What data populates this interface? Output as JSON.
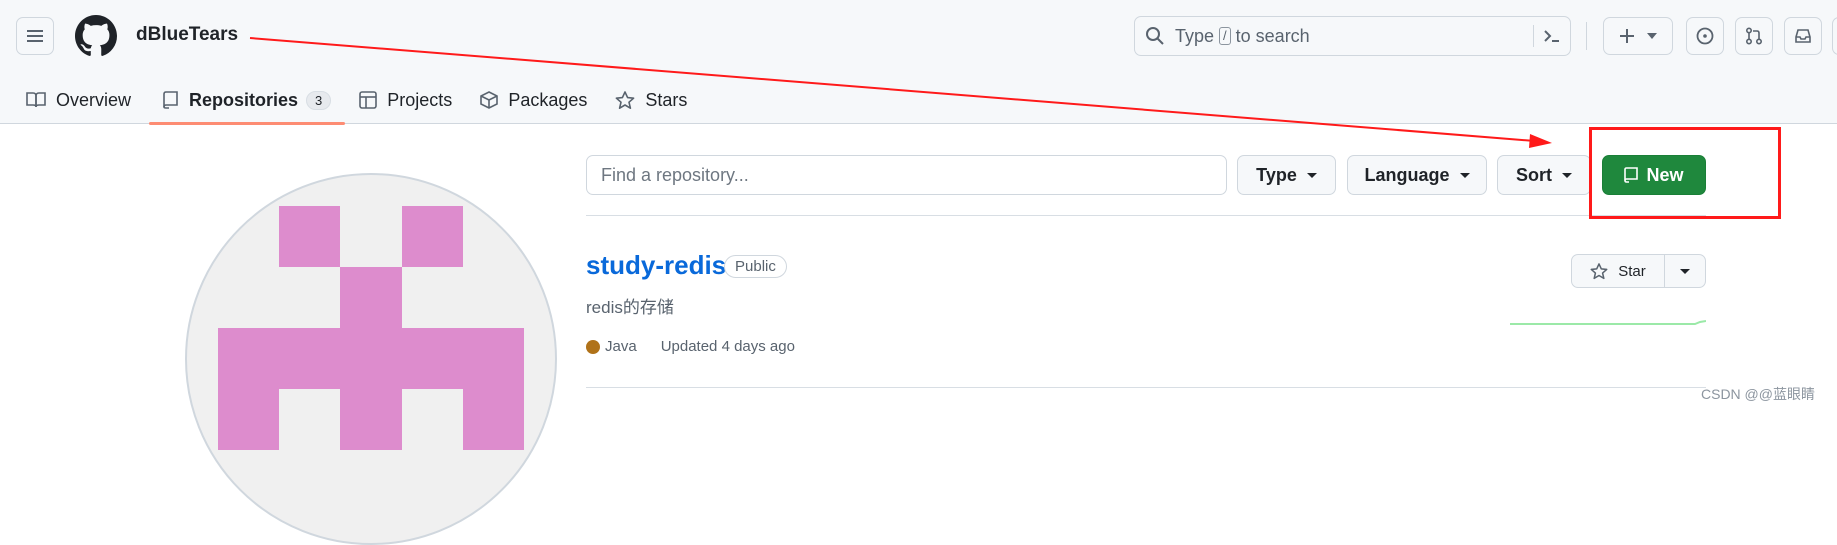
{
  "header": {
    "username": "dBlueTears",
    "search": {
      "prefix": "Type",
      "key": "/",
      "suffix": "to search"
    }
  },
  "tabs": [
    {
      "label": "Overview"
    },
    {
      "label": "Repositories",
      "count": "3"
    },
    {
      "label": "Projects"
    },
    {
      "label": "Packages"
    },
    {
      "label": "Stars"
    }
  ],
  "filter": {
    "find_placeholder": "Find a repository...",
    "type_label": "Type",
    "language_label": "Language",
    "sort_label": "Sort",
    "new_label": "New"
  },
  "repo": {
    "name": "study-redis",
    "visibility": "Public",
    "description": "redis的存储",
    "language": "Java",
    "language_color": "#b07219",
    "updated": "Updated 4 days ago",
    "star_label": "Star"
  },
  "watermark": "CSDN @@蓝眼睛",
  "colors": {
    "accent": "#1f883d",
    "link": "#0969da",
    "annotation": "#ff1a1a",
    "tab_underline": "#fd8c73",
    "avatar_pink": "#dd8ccd"
  }
}
